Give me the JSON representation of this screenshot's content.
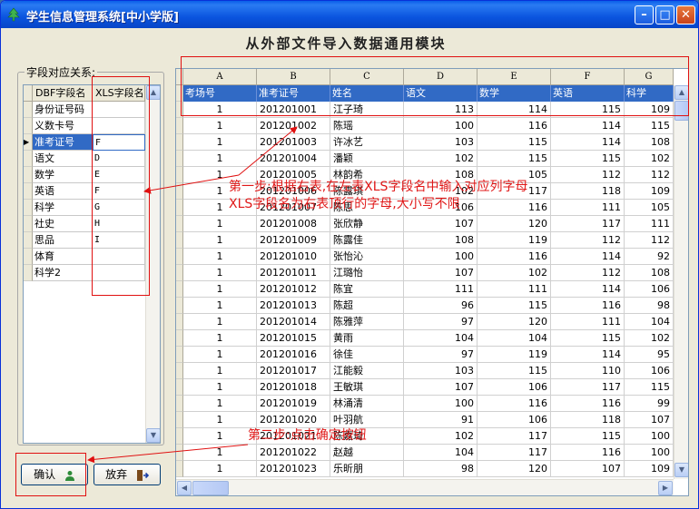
{
  "window": {
    "title": "学生信息管理系统[中小学版]",
    "minimize": "–",
    "maximize": "□",
    "close": "✕"
  },
  "heading": "从外部文件导入数据通用模块",
  "mapping": {
    "group_label": "字段对应关系:",
    "headers": [
      "DBF字段名",
      "XLS字段名"
    ],
    "rows": [
      {
        "dbf": "身份证号码",
        "xls": ""
      },
      {
        "dbf": "义数卡号",
        "xls": ""
      },
      {
        "dbf": "准考证号",
        "xls": "F"
      },
      {
        "dbf": "语文",
        "xls": "D"
      },
      {
        "dbf": "数学",
        "xls": "E"
      },
      {
        "dbf": "英语",
        "xls": "F"
      },
      {
        "dbf": "科学",
        "xls": "G"
      },
      {
        "dbf": "社史",
        "xls": "H"
      },
      {
        "dbf": "思品",
        "xls": "I"
      },
      {
        "dbf": "体育",
        "xls": ""
      },
      {
        "dbf": "科学2",
        "xls": ""
      }
    ],
    "selected_index": 2
  },
  "buttons": {
    "confirm": "确认",
    "cancel": "放弃"
  },
  "sheet": {
    "columns": [
      "A",
      "B",
      "C",
      "D",
      "E",
      "F",
      "G"
    ],
    "fields": [
      "考场号",
      "准考证号",
      "姓名",
      "语文",
      "数学",
      "英语",
      "科学"
    ],
    "rows": [
      [
        "1",
        "201201001",
        "江子琦",
        "113",
        "114",
        "115",
        "109"
      ],
      [
        "1",
        "201201002",
        "陈瑶",
        "100",
        "116",
        "114",
        "115"
      ],
      [
        "1",
        "201201003",
        "许冰艺",
        "103",
        "115",
        "114",
        "108"
      ],
      [
        "1",
        "201201004",
        "潘颖",
        "102",
        "115",
        "115",
        "102"
      ],
      [
        "1",
        "201201005",
        "林韵希",
        "108",
        "105",
        "112",
        "112"
      ],
      [
        "1",
        "201201006",
        "陈露琪",
        "102",
        "117",
        "118",
        "109"
      ],
      [
        "1",
        "201201007",
        "陈思",
        "106",
        "116",
        "111",
        "105"
      ],
      [
        "1",
        "201201008",
        "张欣静",
        "107",
        "120",
        "117",
        "111"
      ],
      [
        "1",
        "201201009",
        "陈露佳",
        "108",
        "119",
        "112",
        "112"
      ],
      [
        "1",
        "201201010",
        "张怡沁",
        "100",
        "116",
        "114",
        "92"
      ],
      [
        "1",
        "201201011",
        "江璐怡",
        "107",
        "102",
        "112",
        "108"
      ],
      [
        "1",
        "201201012",
        "陈宜",
        "111",
        "111",
        "114",
        "106"
      ],
      [
        "1",
        "201201013",
        "陈超",
        "96",
        "115",
        "116",
        "98"
      ],
      [
        "1",
        "201201014",
        "陈雅萍",
        "97",
        "120",
        "111",
        "104"
      ],
      [
        "1",
        "201201015",
        "黄雨",
        "104",
        "104",
        "115",
        "102"
      ],
      [
        "1",
        "201201016",
        "徐佳",
        "97",
        "119",
        "114",
        "95"
      ],
      [
        "1",
        "201201017",
        "江能毅",
        "103",
        "115",
        "110",
        "106"
      ],
      [
        "1",
        "201201018",
        "王敏琪",
        "107",
        "106",
        "117",
        "115"
      ],
      [
        "1",
        "201201019",
        "林涌清",
        "100",
        "116",
        "116",
        "99"
      ],
      [
        "1",
        "201201020",
        "叶羽航",
        "91",
        "106",
        "118",
        "107"
      ],
      [
        "1",
        "201201021",
        "陈嘉琦",
        "102",
        "117",
        "115",
        "100"
      ],
      [
        "1",
        "201201022",
        "赵越",
        "104",
        "117",
        "116",
        "100"
      ],
      [
        "1",
        "201201023",
        "乐昕朋",
        "98",
        "120",
        "107",
        "109"
      ]
    ]
  },
  "annotations": {
    "step1_line1": "第一步:根据右表,在左表XLS字段名中输入对应列字母",
    "step1_line2": "XLS字段名为右表顶行的字母,大小写不限",
    "step2": "第二步:点击确定按钮"
  },
  "colors": {
    "selection": "#316ac5",
    "annotation": "#e01010",
    "title_bar": "#0a54df"
  }
}
